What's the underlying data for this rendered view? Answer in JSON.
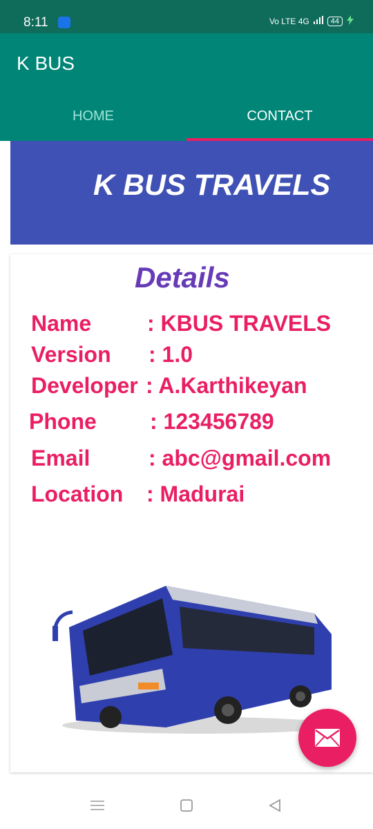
{
  "status_bar": {
    "time": "8:11",
    "network": "Vo LTE  4G",
    "battery": "44"
  },
  "app_bar": {
    "title": "K BUS"
  },
  "tabs": [
    {
      "label": "HOME"
    },
    {
      "label": "CONTACT"
    }
  ],
  "banner": {
    "title": "K BUS TRAVELS"
  },
  "details": {
    "heading": "Details",
    "rows": [
      {
        "label": "Name",
        "value": ":  KBUS TRAVELS"
      },
      {
        "label": "Version",
        "value": ": 1.0"
      },
      {
        "label": "Developer",
        "value": ":  A.Karthikeyan"
      },
      {
        "label": "Phone",
        "value": ": 123456789"
      },
      {
        "label": "Email",
        "value": ": abc@gmail.com"
      },
      {
        "label": "Location",
        "value": ": Madurai"
      }
    ]
  },
  "colors": {
    "primary": "#008576",
    "accent": "#e91e63",
    "banner": "#3f51b5",
    "heading": "#673ab7"
  },
  "icons": {
    "fab": "mail-icon",
    "nav": [
      "menu-icon",
      "home-square-icon",
      "back-triangle-icon"
    ]
  }
}
